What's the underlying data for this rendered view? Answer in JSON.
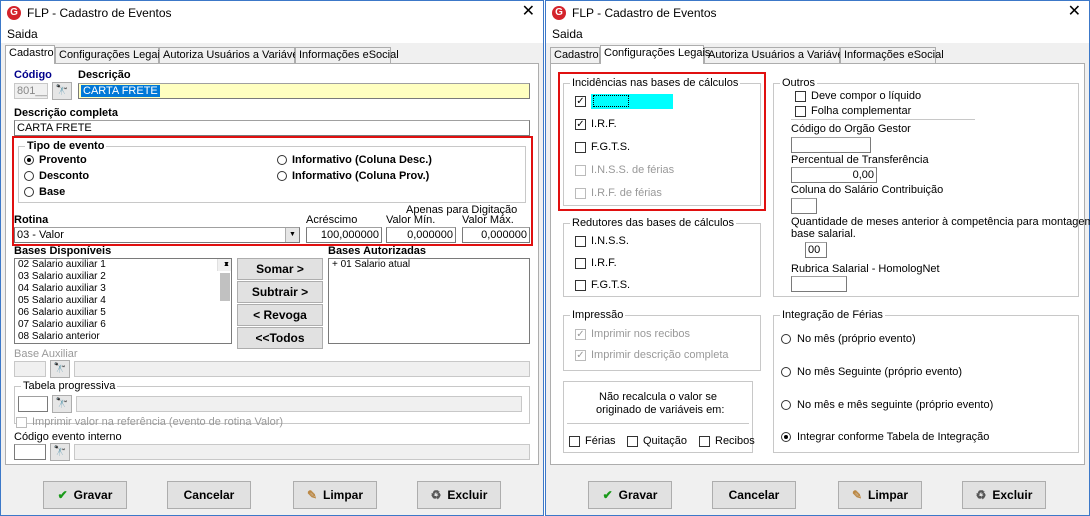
{
  "app": {
    "title": "FLP - Cadastro de Eventos",
    "menu": "Saida"
  },
  "tabs": [
    "Cadastro",
    "Configurações Legais",
    "Autoriza Usuários a Variáveis",
    "Informações eSocial"
  ],
  "cadastro": {
    "codigo_label": "Código",
    "codigo_value": "801__",
    "descricao_label": "Descrição",
    "descricao_value": "CARTA FRETE",
    "descricao_completa_label": "Descrição completa",
    "descricao_completa_value": "CARTA FRETE",
    "tipo_evento": {
      "title": "Tipo de evento",
      "options": [
        "Provento",
        "Desconto",
        "Base",
        "Informativo (Coluna Desc.)",
        "Informativo (Coluna Prov.)"
      ],
      "selected": "Provento"
    },
    "rotina_label": "Rotina",
    "rotina_value": "03 - Valor",
    "acrescimo_label": "Acréscimo",
    "acrescimo_value": "100,000000",
    "apenas_label": "Apenas para Digitação",
    "valor_min_label": "Valor Mín.",
    "valor_min_value": "0,000000",
    "valor_max_label": "Valor Máx.",
    "valor_max_value": "0,000000",
    "bases_disponiveis_label": "Bases Disponíveis",
    "bases_disponiveis": [
      "02 Salario auxiliar 1",
      "03 Salario auxiliar 2",
      "04 Salario auxiliar 3",
      "05 Salario auxiliar 4",
      "06 Salario auxiliar 5",
      "07 Salario auxiliar 6",
      "08 Salario anterior"
    ],
    "bases_autorizadas_label": "Bases Autorizadas",
    "bases_autorizadas": [
      "+ 01 Salario atual"
    ],
    "btn_somar": "Somar >",
    "btn_subtrair": "Subtrair >",
    "btn_revoga": "< Revoga",
    "btn_todos": "<<Todos",
    "base_auxiliar_label": "Base Auxiliar",
    "tabela_progressiva_label": "Tabela progressiva",
    "imprimir_label": "Imprimir valor na referência (evento de rotina Valor)",
    "codigo_interno_label": "Código evento interno"
  },
  "legais": {
    "incidencias_title": "Incidências nas bases de cálculos",
    "incidencias": [
      {
        "label": "",
        "checked": true,
        "enabled": true
      },
      {
        "label": "I.R.F.",
        "checked": true,
        "enabled": true
      },
      {
        "label": "F.G.T.S.",
        "checked": false,
        "enabled": true
      },
      {
        "label": "I.N.S.S. de férias",
        "checked": false,
        "enabled": false
      },
      {
        "label": "I.R.F. de férias",
        "checked": false,
        "enabled": false
      }
    ],
    "redutores_title": "Redutores das bases de cálculos",
    "redutores": [
      "I.N.S.S.",
      "I.R.F.",
      "F.G.T.S."
    ],
    "impressao_title": "Impressão",
    "impressao": [
      "Imprimir nos recibos",
      "Imprimir descrição completa"
    ],
    "nao_recalcula_text1": "Não recalcula o valor se",
    "nao_recalcula_text2": "originado de variáveis em:",
    "nao_recalcula_opts": [
      "Férias",
      "Quitação",
      "Recibos"
    ],
    "outros_title": "Outros",
    "outros_checks": [
      "Deve compor o líquido",
      "Folha complementar"
    ],
    "orgao_gestor_label": "Código do Orgão Gestor",
    "percentual_label": "Percentual de Transferência",
    "percentual_value": "0,00",
    "coluna_salario_label": "Coluna do Salário Contribuição",
    "qtd_meses_label1": "Quantidade de meses anterior à competência para montagem da",
    "qtd_meses_label2": "base salarial.",
    "qtd_meses_value": "00",
    "rubrica_label": "Rubrica Salarial - HomologNet",
    "integracao_title": "Integração de Férias",
    "integracao_opts": [
      "No mês (próprio evento)",
      "No mês Seguinte (próprio evento)",
      "No mês e mês seguinte (próprio evento)",
      "Integrar conforme Tabela de Integração"
    ],
    "integracao_selected": "Integrar conforme Tabela de Integração"
  },
  "footer": {
    "gravar": "Gravar",
    "cancelar": "Cancelar",
    "limpar": "Limpar",
    "excluir": "Excluir"
  }
}
